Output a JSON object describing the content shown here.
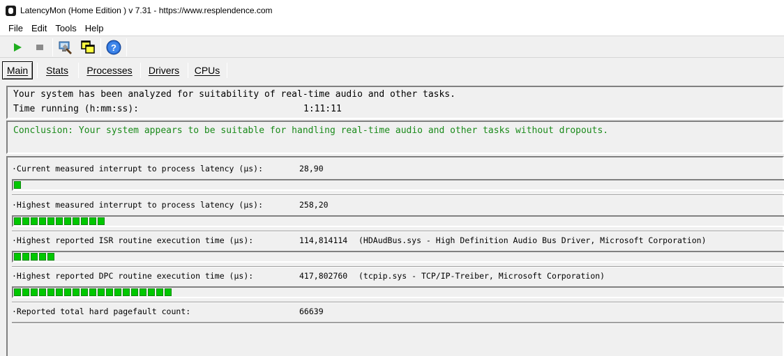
{
  "window": {
    "title": "LatencyMon  (Home Edition )  v 7.31 - https://www.resplendence.com"
  },
  "menu": {
    "items": [
      "File",
      "Edit",
      "Tools",
      "Help"
    ]
  },
  "toolbar": {
    "buttons": [
      "play-icon",
      "stop-icon",
      "drivers-icon",
      "windows-icon",
      "help-icon"
    ]
  },
  "tabs": {
    "items": [
      "Main",
      "Stats",
      "Processes",
      "Drivers",
      "CPUs"
    ],
    "active": "Main"
  },
  "summary": {
    "analyzed_text": "Your system has been analyzed for suitability of real-time audio and other tasks.",
    "time_label": "Time running (h:mm:ss):",
    "time_value": "1:11:11"
  },
  "conclusion": {
    "text": "Conclusion: Your system appears to be suitable for handling real-time audio and other tasks without dropouts.",
    "color": "#1a8a1a"
  },
  "metrics": [
    {
      "label": "·Current measured interrupt to process latency (µs):",
      "value": "28,90",
      "detail": "",
      "bar_segments": 1,
      "bar_type": "segments"
    },
    {
      "label": "·Highest measured interrupt to process latency (µs):",
      "value": "258,20",
      "detail": "",
      "bar_segments": 11,
      "bar_type": "segments"
    },
    {
      "label": "·Highest reported ISR routine execution time (µs):",
      "value": "114,814114",
      "detail": "(HDAudBus.sys - High Definition Audio Bus Driver, Microsoft Corporation)",
      "bar_segments": 5,
      "bar_type": "segments"
    },
    {
      "label": "·Highest reported DPC routine execution time (µs):",
      "value": "417,802760",
      "detail": "(tcpip.sys - TCP/IP-Treiber, Microsoft Corporation)",
      "bar_segments": 19,
      "bar_type": "segments"
    },
    {
      "label": "·Reported total hard pagefault count:",
      "value": "66639",
      "detail": "",
      "bar_segments": 0,
      "bar_type": "thin"
    }
  ],
  "colors": {
    "bar_green": "#00c800",
    "bar_border": "#0a8a0a"
  }
}
